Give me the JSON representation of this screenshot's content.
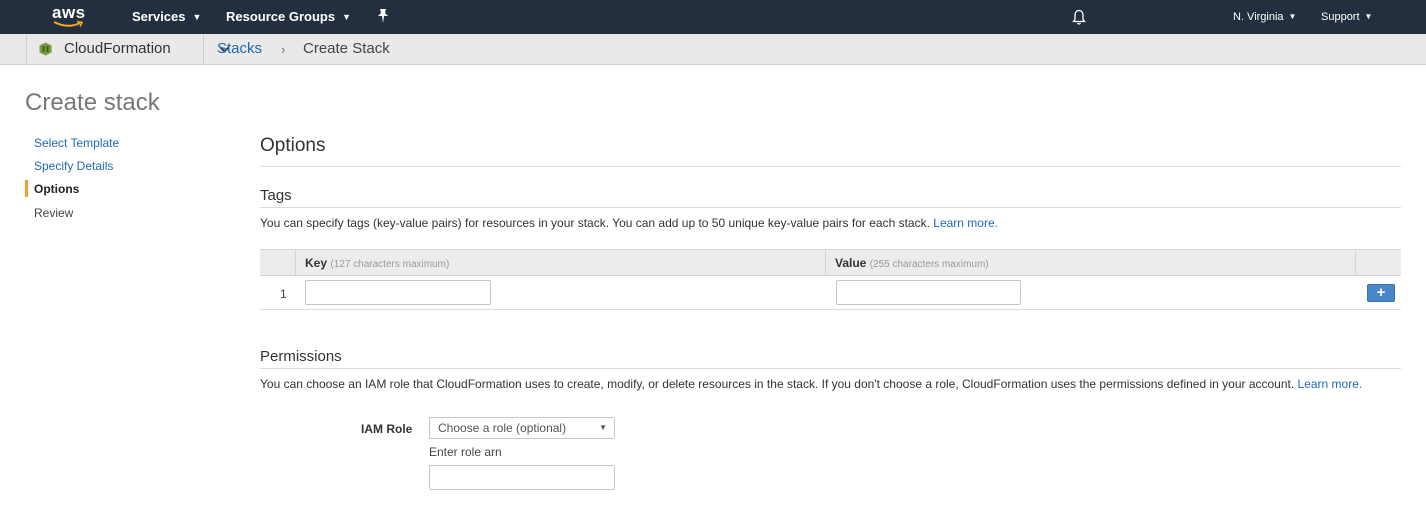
{
  "topnav": {
    "logo_text": "aws",
    "services": "Services",
    "resource_groups": "Resource Groups",
    "region": "N. Virginia",
    "support": "Support",
    "bg_color": "#232f3e"
  },
  "subnav": {
    "service_name": "CloudFormation",
    "breadcrumb_link": "Stacks",
    "breadcrumb_sep": "›",
    "breadcrumb_current": "Create Stack"
  },
  "page": {
    "title": "Create stack"
  },
  "steps": [
    {
      "label": "Select Template",
      "state": "link"
    },
    {
      "label": "Specify Details",
      "state": "link"
    },
    {
      "label": "Options",
      "state": "active"
    },
    {
      "label": "Review",
      "state": "plain"
    }
  ],
  "options": {
    "heading": "Options",
    "tags": {
      "heading": "Tags",
      "description": "You can specify tags (key-value pairs) for resources in your stack. You can add up to 50 unique key-value pairs for each stack.",
      "learn_more": "Learn more.",
      "key_header": "Key",
      "key_hint": "(127 characters maximum)",
      "value_header": "Value",
      "value_hint": "(255 characters maximum)",
      "rows": [
        {
          "num": "1",
          "key": "",
          "value": ""
        }
      ],
      "add_button": "+"
    },
    "permissions": {
      "heading": "Permissions",
      "description": "You can choose an IAM role that CloudFormation uses to create, modify, or delete resources in the stack. If you don't choose a role, CloudFormation uses the permissions defined in your account.",
      "learn_more": "Learn more.",
      "iam_role_label": "IAM Role",
      "select_value": "Choose a role (optional)",
      "role_arn_label": "Enter role arn",
      "role_arn_value": ""
    }
  },
  "colors": {
    "link": "#1e6ab5",
    "active_step_bar": "#f0a030",
    "add_button": "#4a87c8"
  }
}
